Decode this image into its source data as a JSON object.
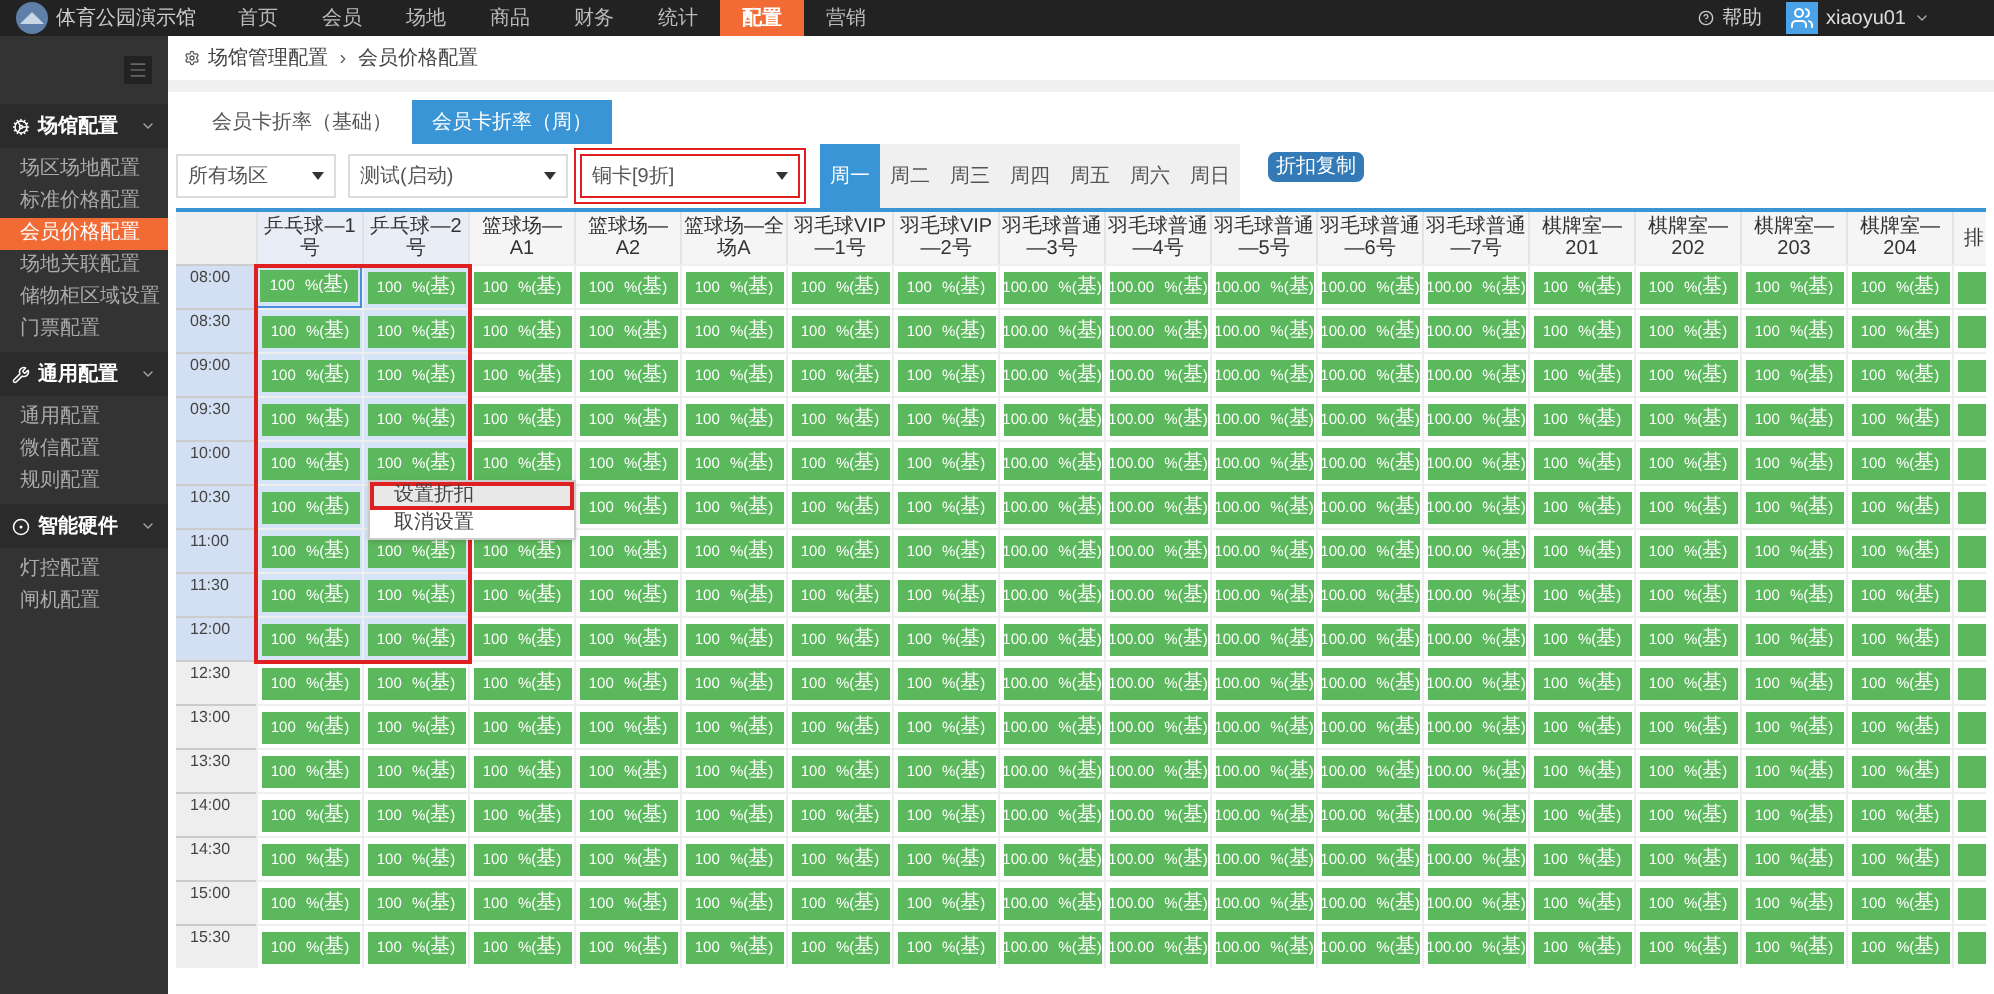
{
  "topbar": {
    "title": "体育公园演示馆",
    "nav": [
      {
        "label": "首页",
        "selected": false
      },
      {
        "label": "会员",
        "selected": false
      },
      {
        "label": "场地",
        "selected": false
      },
      {
        "label": "商品",
        "selected": false
      },
      {
        "label": "财务",
        "selected": false
      },
      {
        "label": "统计",
        "selected": false
      },
      {
        "label": "配置",
        "selected": true
      },
      {
        "label": "营销",
        "selected": false
      }
    ],
    "help": "帮助",
    "user": "xiaoyu01"
  },
  "sidebar": {
    "sections": [
      {
        "label": "场馆配置",
        "kind": "venue",
        "expanded": true,
        "items": [
          {
            "label": "场区场地配置",
            "selected": false
          },
          {
            "label": "标准价格配置",
            "selected": false
          },
          {
            "label": "会员价格配置",
            "selected": true
          },
          {
            "label": "场地关联配置",
            "selected": false
          },
          {
            "label": "储物柜区域设置",
            "selected": false
          },
          {
            "label": "门票配置",
            "selected": false
          }
        ]
      },
      {
        "label": "通用配置",
        "kind": "general",
        "expanded": true,
        "items": [
          {
            "label": "通用配置",
            "selected": false
          },
          {
            "label": "微信配置",
            "selected": false
          },
          {
            "label": "规则配置",
            "selected": false
          }
        ]
      },
      {
        "label": "智能硬件",
        "kind": "hardware",
        "expanded": true,
        "items": [
          {
            "label": "灯控配置",
            "selected": false
          },
          {
            "label": "闸机配置",
            "selected": false
          }
        ]
      }
    ]
  },
  "breadcrumb": [
    "场馆管理配置",
    "会员价格配置"
  ],
  "tabs": [
    {
      "label": "会员卡折率（基础）",
      "selected": false
    },
    {
      "label": "会员卡折率（周）",
      "selected": true
    }
  ],
  "filters": [
    {
      "value": "所有场区",
      "annotated": false
    },
    {
      "value": "测试(启动)",
      "annotated": false
    },
    {
      "value": "铜卡[9折]",
      "annotated": true
    }
  ],
  "days": [
    {
      "label": "周一",
      "selected": true
    },
    {
      "label": "周二",
      "selected": false
    },
    {
      "label": "周三",
      "selected": false
    },
    {
      "label": "周四",
      "selected": false
    },
    {
      "label": "周五",
      "selected": false
    },
    {
      "label": "周六",
      "selected": false
    },
    {
      "label": "周日",
      "selected": false
    }
  ],
  "copy_button": "折扣复制",
  "table": {
    "selection_annotated": true,
    "columns": [
      {
        "label": "乒乓球—1号",
        "selected": true
      },
      {
        "label": "乒乓球—2号",
        "selected": true
      },
      {
        "label": "篮球场—A1",
        "selected": false
      },
      {
        "label": "篮球场—A2",
        "selected": false
      },
      {
        "label": "篮球场—全场A",
        "selected": false
      },
      {
        "label": "羽毛球VIP—1号",
        "selected": false
      },
      {
        "label": "羽毛球VIP—2号",
        "selected": false
      },
      {
        "label": "羽毛球普通—3号",
        "selected": false
      },
      {
        "label": "羽毛球普通—4号",
        "selected": false
      },
      {
        "label": "羽毛球普通—5号",
        "selected": false
      },
      {
        "label": "羽毛球普通—6号",
        "selected": false
      },
      {
        "label": "羽毛球普通—7号",
        "selected": false
      },
      {
        "label": "棋牌室—201",
        "selected": false
      },
      {
        "label": "棋牌室—202",
        "selected": false
      },
      {
        "label": "棋牌室—203",
        "selected": false
      },
      {
        "label": "棋牌室—204",
        "selected": false
      },
      {
        "label": "排",
        "selected": false
      }
    ],
    "rows": [
      {
        "time": "08:00",
        "selected": true,
        "cells": [
          "100 %(基)",
          "100 %(基)",
          "100 %(基)",
          "100 %(基)",
          "100 %(基)",
          "100 %(基)",
          "100 %(基)",
          "100.00 %(基)",
          "100.00 %(基)",
          "100.00 %(基)",
          "100.00 %(基)",
          "100.00 %(基)",
          "100 %(基)",
          "100 %(基)",
          "100 %(基)",
          "100 %(基)"
        ]
      },
      {
        "time": "08:30",
        "selected": true,
        "cells": [
          "100 %(基)",
          "100 %(基)",
          "100 %(基)",
          "100 %(基)",
          "100 %(基)",
          "100 %(基)",
          "100 %(基)",
          "100.00 %(基)",
          "100.00 %(基)",
          "100.00 %(基)",
          "100.00 %(基)",
          "100.00 %(基)",
          "100 %(基)",
          "100 %(基)",
          "100 %(基)",
          "100 %(基)"
        ]
      },
      {
        "time": "09:00",
        "selected": true,
        "cells": [
          "100 %(基)",
          "100 %(基)",
          "100 %(基)",
          "100 %(基)",
          "100 %(基)",
          "100 %(基)",
          "100 %(基)",
          "100.00 %(基)",
          "100.00 %(基)",
          "100.00 %(基)",
          "100.00 %(基)",
          "100.00 %(基)",
          "100 %(基)",
          "100 %(基)",
          "100 %(基)",
          "100 %(基)"
        ]
      },
      {
        "time": "09:30",
        "selected": true,
        "cells": [
          "100 %(基)",
          "100 %(基)",
          "100 %(基)",
          "100 %(基)",
          "100 %(基)",
          "100 %(基)",
          "100 %(基)",
          "100.00 %(基)",
          "100.00 %(基)",
          "100.00 %(基)",
          "100.00 %(基)",
          "100.00 %(基)",
          "100 %(基)",
          "100 %(基)",
          "100 %(基)",
          "100 %(基)"
        ]
      },
      {
        "time": "10:00",
        "selected": true,
        "cells": [
          "100 %(基)",
          "100 %(基)",
          "100 %(基)",
          "100 %(基)",
          "100 %(基)",
          "100 %(基)",
          "100 %(基)",
          "100.00 %(基)",
          "100.00 %(基)",
          "100.00 %(基)",
          "100.00 %(基)",
          "100.00 %(基)",
          "100 %(基)",
          "100 %(基)",
          "100 %(基)",
          "100 %(基)"
        ]
      },
      {
        "time": "10:30",
        "selected": true,
        "cells": [
          "100 %(基)",
          null,
          null,
          "100 %(基)",
          "100 %(基)",
          "100 %(基)",
          "100 %(基)",
          "100.00 %(基)",
          "100.00 %(基)",
          "100.00 %(基)",
          "100.00 %(基)",
          "100.00 %(基)",
          "100 %(基)",
          "100 %(基)",
          "100 %(基)",
          "100 %(基)"
        ]
      },
      {
        "time": "11:00",
        "selected": true,
        "cells": [
          "100 %(基)",
          "100 %(基)",
          "100 %(基)",
          "100 %(基)",
          "100 %(基)",
          "100 %(基)",
          "100 %(基)",
          "100.00 %(基)",
          "100.00 %(基)",
          "100.00 %(基)",
          "100.00 %(基)",
          "100.00 %(基)",
          "100 %(基)",
          "100 %(基)",
          "100 %(基)",
          "100 %(基)"
        ]
      },
      {
        "time": "11:30",
        "selected": true,
        "cells": [
          "100 %(基)",
          "100 %(基)",
          "100 %(基)",
          "100 %(基)",
          "100 %(基)",
          "100 %(基)",
          "100 %(基)",
          "100.00 %(基)",
          "100.00 %(基)",
          "100.00 %(基)",
          "100.00 %(基)",
          "100.00 %(基)",
          "100 %(基)",
          "100 %(基)",
          "100 %(基)",
          "100 %(基)"
        ]
      },
      {
        "time": "12:00",
        "selected": true,
        "cells": [
          "100 %(基)",
          "100 %(基)",
          "100 %(基)",
          "100 %(基)",
          "100 %(基)",
          "100 %(基)",
          "100 %(基)",
          "100.00 %(基)",
          "100.00 %(基)",
          "100.00 %(基)",
          "100.00 %(基)",
          "100.00 %(基)",
          "100 %(基)",
          "100 %(基)",
          "100 %(基)",
          "100 %(基)"
        ]
      },
      {
        "time": "12:30",
        "selected": false,
        "cells": [
          "100 %(基)",
          "100 %(基)",
          "100 %(基)",
          "100 %(基)",
          "100 %(基)",
          "100 %(基)",
          "100 %(基)",
          "100.00 %(基)",
          "100.00 %(基)",
          "100.00 %(基)",
          "100.00 %(基)",
          "100.00 %(基)",
          "100 %(基)",
          "100 %(基)",
          "100 %(基)",
          "100 %(基)"
        ]
      },
      {
        "time": "13:00",
        "selected": false,
        "cells": [
          "100 %(基)",
          "100 %(基)",
          "100 %(基)",
          "100 %(基)",
          "100 %(基)",
          "100 %(基)",
          "100 %(基)",
          "100.00 %(基)",
          "100.00 %(基)",
          "100.00 %(基)",
          "100.00 %(基)",
          "100.00 %(基)",
          "100 %(基)",
          "100 %(基)",
          "100 %(基)",
          "100 %(基)"
        ]
      },
      {
        "time": "13:30",
        "selected": false,
        "cells": [
          "100 %(基)",
          "100 %(基)",
          "100 %(基)",
          "100 %(基)",
          "100 %(基)",
          "100 %(基)",
          "100 %(基)",
          "100.00 %(基)",
          "100.00 %(基)",
          "100.00 %(基)",
          "100.00 %(基)",
          "100.00 %(基)",
          "100 %(基)",
          "100 %(基)",
          "100 %(基)",
          "100 %(基)"
        ]
      },
      {
        "time": "14:00",
        "selected": false,
        "cells": [
          "100 %(基)",
          "100 %(基)",
          "100 %(基)",
          "100 %(基)",
          "100 %(基)",
          "100 %(基)",
          "100 %(基)",
          "100.00 %(基)",
          "100.00 %(基)",
          "100.00 %(基)",
          "100.00 %(基)",
          "100.00 %(基)",
          "100 %(基)",
          "100 %(基)",
          "100 %(基)",
          "100 %(基)"
        ]
      },
      {
        "time": "14:30",
        "selected": false,
        "cells": [
          "100 %(基)",
          "100 %(基)",
          "100 %(基)",
          "100 %(基)",
          "100 %(基)",
          "100 %(基)",
          "100 %(基)",
          "100.00 %(基)",
          "100.00 %(基)",
          "100.00 %(基)",
          "100.00 %(基)",
          "100.00 %(基)",
          "100 %(基)",
          "100 %(基)",
          "100 %(基)",
          "100 %(基)"
        ]
      },
      {
        "time": "15:00",
        "selected": false,
        "cells": [
          "100 %(基)",
          "100 %(基)",
          "100 %(基)",
          "100 %(基)",
          "100 %(基)",
          "100 %(基)",
          "100 %(基)",
          "100.00 %(基)",
          "100.00 %(基)",
          "100.00 %(基)",
          "100.00 %(基)",
          "100.00 %(基)",
          "100 %(基)",
          "100 %(基)",
          "100 %(基)",
          "100 %(基)"
        ]
      },
      {
        "time": "15:30",
        "selected": false,
        "cells": [
          "100 %(基)",
          "100 %(基)",
          "100 %(基)",
          "100 %(基)",
          "100 %(基)",
          "100 %(基)",
          "100 %(基)",
          "100.00 %(基)",
          "100.00 %(基)",
          "100.00 %(基)",
          "100.00 %(基)",
          "100.00 %(基)",
          "100 %(基)",
          "100 %(基)",
          "100 %(基)",
          "100 %(基)"
        ]
      }
    ]
  },
  "context_menu": [
    {
      "label": "设置折扣",
      "highlighted": true,
      "annotated": true
    },
    {
      "label": "取消设置",
      "highlighted": false,
      "annotated": false
    }
  ]
}
